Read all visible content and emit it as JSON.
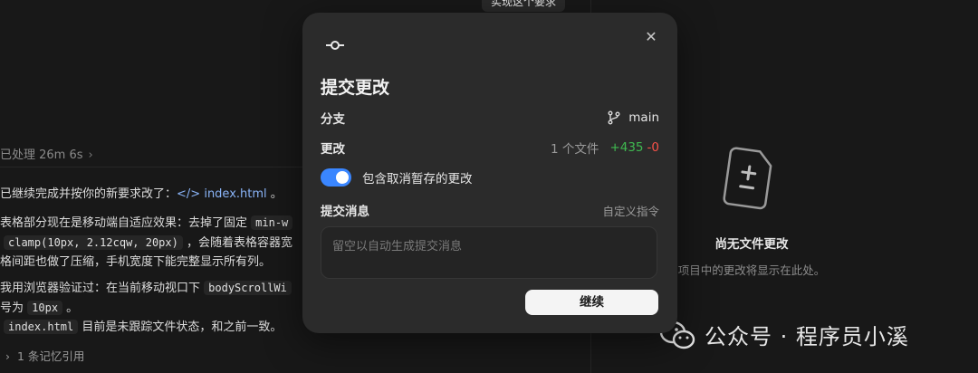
{
  "top_tooltip": "实现这个要求",
  "left": {
    "processed": "已处理 26m 6s",
    "lines": [
      {
        "parts": [
          {
            "t": "已继续完成并按你的新要求改了：",
            "k": "text"
          },
          {
            "t": "</> ",
            "k": "link"
          },
          {
            "t": "index.html",
            "k": "link"
          },
          {
            "t": " 。",
            "k": "text"
          }
        ]
      },
      {
        "parts": [
          {
            "t": "表格部分现在是移动端自适应效果：去掉了固定 ",
            "k": "text"
          },
          {
            "t": "min-w",
            "k": "code"
          }
        ]
      },
      {
        "parts": [
          {
            "t": "clamp(10px, 2.12cqw, 20px)",
            "k": "code"
          },
          {
            "t": " ，会随着表格容器宽",
            "k": "text"
          }
        ]
      },
      {
        "parts": [
          {
            "t": "格间距也做了压缩，手机宽度下能完整显示所有列。",
            "k": "text"
          }
        ]
      },
      {
        "parts": [
          {
            "t": "我用浏览器验证过：在当前移动视口下 ",
            "k": "text"
          },
          {
            "t": "bodyScrollWi",
            "k": "code"
          }
        ]
      },
      {
        "parts": [
          {
            "t": "号为 ",
            "k": "text"
          },
          {
            "t": "10px",
            "k": "code"
          },
          {
            "t": " 。",
            "k": "text"
          }
        ]
      },
      {
        "parts": [
          {
            "t": "index.html",
            "k": "code"
          },
          {
            "t": " 目前是未跟踪文件状态，和之前一致。",
            "k": "text"
          }
        ]
      }
    ],
    "memory": "1 条记忆引用"
  },
  "right": {
    "empty_title": "尚无文件更改",
    "empty_sub": "项目中的更改将显示在此处。"
  },
  "watermark": "公众号 · 程序员小溪",
  "dialog": {
    "title": "提交更改",
    "branch_label": "分支",
    "branch_value": "main",
    "changes_label": "更改",
    "files_count": "1 个文件",
    "additions": "+435",
    "deletions": "-0",
    "include_unstaged_label": "包含取消暂存的更改",
    "include_unstaged_on": true,
    "commit_msg_label": "提交消息",
    "custom_instructions": "自定义指令",
    "commit_msg_placeholder": "留空以自动生成提交消息",
    "continue_label": "继续"
  },
  "colors": {
    "accent": "#3a86ff",
    "additions": "#3fb950",
    "deletions": "#f85149",
    "link": "#8ab4f8"
  }
}
